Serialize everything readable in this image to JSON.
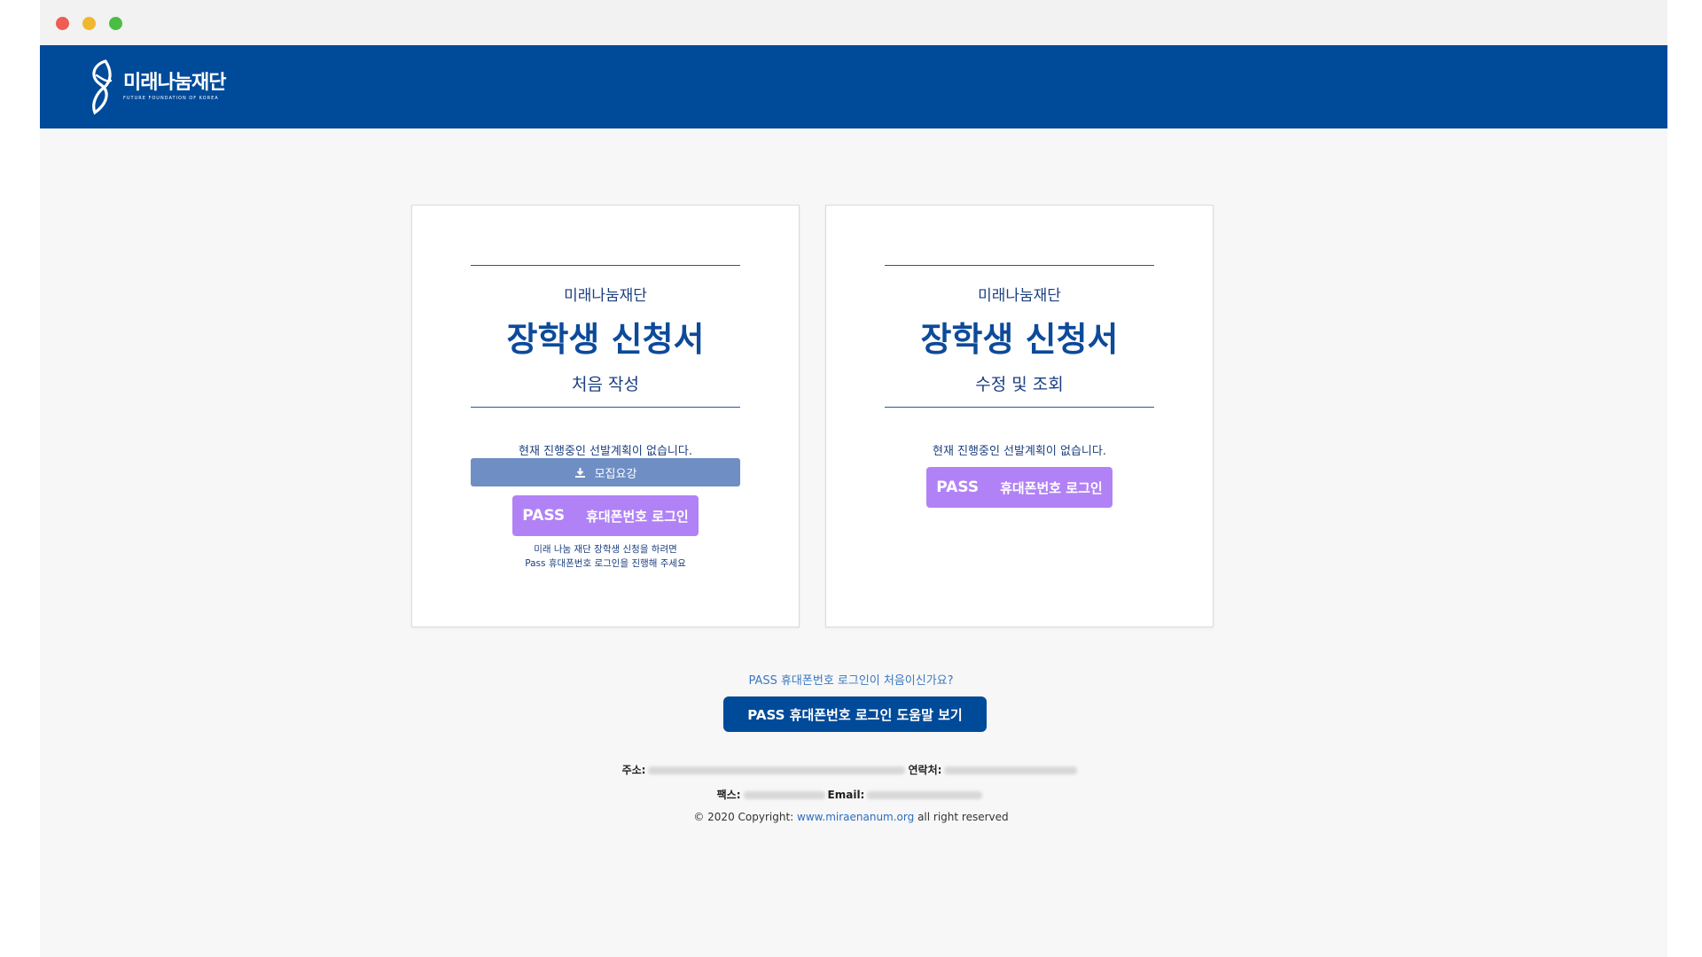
{
  "window": {
    "controls": [
      "close",
      "minimize",
      "maximize"
    ]
  },
  "header": {
    "logo_name": "미래나눔재단",
    "logo_tagline": "FUTURE FOUNDATION OF KOREA",
    "bg_color": "#004a9a"
  },
  "cards": [
    {
      "org": "미래나눔재단",
      "title": "장학생 신청서",
      "subtitle": "처음 작성",
      "notice": "현재 진행중인 선발계획이 없습니다.",
      "download_label": "모집요강",
      "pass_brand": "PASS",
      "pass_label": "휴대폰번호 로그인",
      "help_line1": "미래 나눔 재단 장학생 신청을 하려면",
      "help_line2": "Pass 휴대폰번호 로그인을 진행해 주세요"
    },
    {
      "org": "미래나눔재단",
      "title": "장학생 신청서",
      "subtitle": "수정 및 조회",
      "notice": "현재 진행중인 선발계획이 없습니다.",
      "pass_brand": "PASS",
      "pass_label": "휴대폰번호 로그인"
    }
  ],
  "pass_help": {
    "question": "PASS 휴대폰번호 로그인이 처음이신가요?",
    "button": "PASS 휴대폰번호 로그인 도움말 보기"
  },
  "footer": {
    "address_label": "주소:",
    "contact_label": "연락처:",
    "fax_label": "팩스:",
    "email_label": "Email:",
    "copyright_prefix": "© 2020 Copyright:",
    "website": "www.miraenanum.org",
    "copyright_suffix": "all right reserved"
  },
  "colors": {
    "primary": "#004a9a",
    "pass": "#b182f5",
    "download": "#6f8ec4",
    "link": "#2d6cc0"
  }
}
